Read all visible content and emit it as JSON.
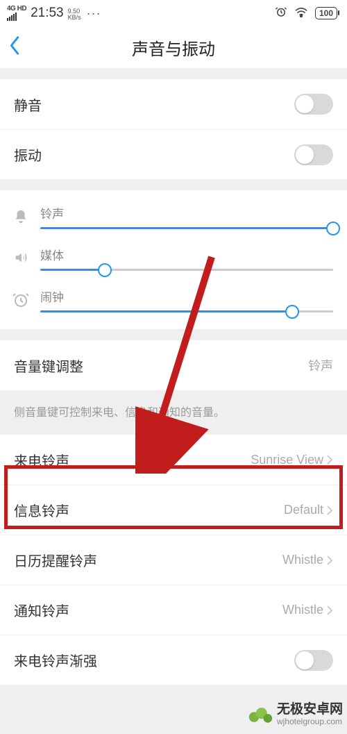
{
  "status": {
    "network_type": "4G HD",
    "time": "21:53",
    "netspeed_top": "9.50",
    "netspeed_bot": "KB/s",
    "battery": "100"
  },
  "header": {
    "title": "声音与振动"
  },
  "toggles": {
    "mute": {
      "label": "静音",
      "on": false
    },
    "vibrate": {
      "label": "振动",
      "on": false
    }
  },
  "sliders": {
    "ringtone": {
      "label": "铃声",
      "percent": 100
    },
    "media": {
      "label": "媒体",
      "percent": 22
    },
    "alarm": {
      "label": "闹钟",
      "percent": 86
    }
  },
  "volume_key": {
    "label": "音量键调整",
    "value": "铃声",
    "hint": "侧音量键可控制来电、信息和通知的音量。"
  },
  "ringtones": {
    "incoming": {
      "label": "来电铃声",
      "value": "Sunrise View"
    },
    "message": {
      "label": "信息铃声",
      "value": "Default"
    },
    "calendar": {
      "label": "日历提醒铃声",
      "value": "Whistle"
    },
    "notification": {
      "label": "通知铃声",
      "value": "Whistle"
    },
    "ascending": {
      "label": "来电铃声渐强",
      "on": false
    }
  },
  "watermark": {
    "cn": "无极安卓网",
    "en": "wjhotelgroup.com"
  },
  "annotation": {
    "highlight_target": "incoming-ringtone"
  }
}
